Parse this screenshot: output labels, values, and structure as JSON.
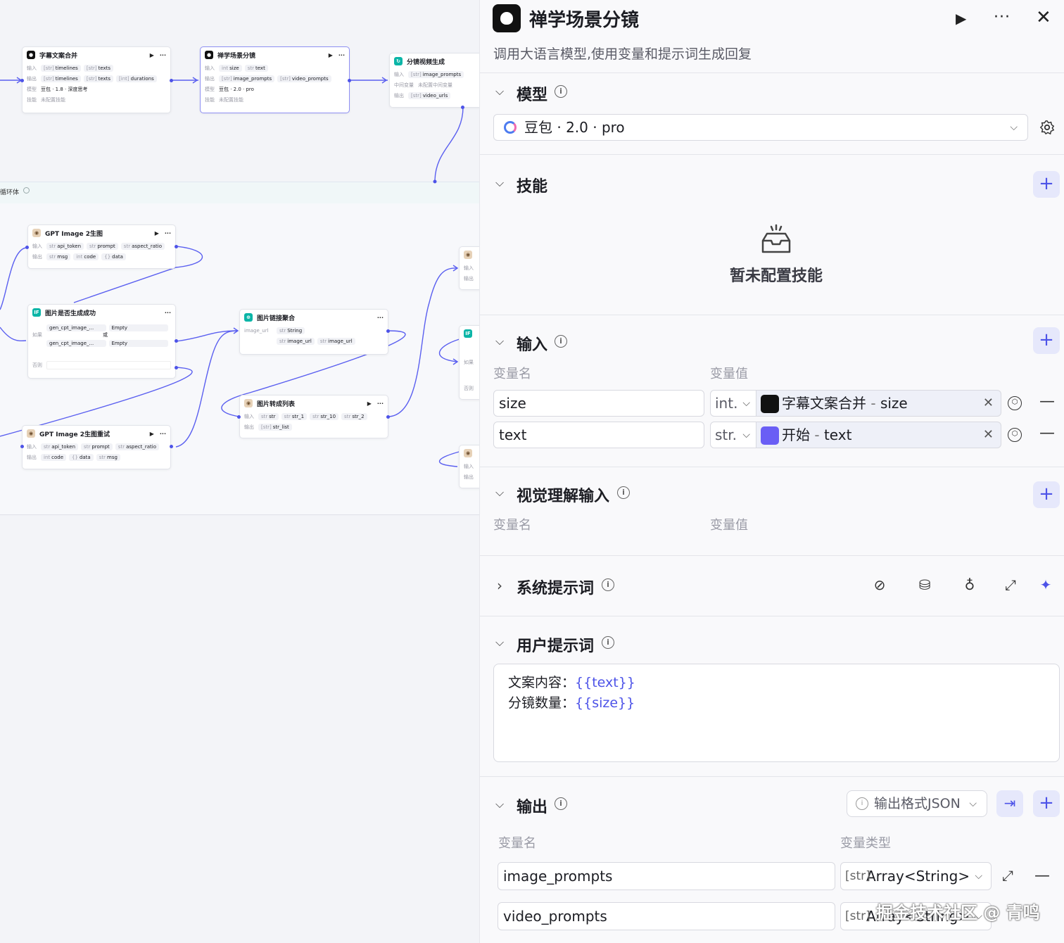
{
  "canvas": {
    "loop_label": "循环体",
    "labels": {
      "input": "输入",
      "output": "输出",
      "model": "模型",
      "skill": "技能",
      "if": "如果",
      "else": "否则",
      "mid_var": "中间变量"
    },
    "nodes": {
      "subtitle_merge": {
        "title": "字幕文案合并",
        "in": [
          "timelines",
          "texts"
        ],
        "out": [
          "timelines",
          "texts",
          "durations"
        ],
        "model": "豆包 · 1.8 · 深度思考",
        "skill": "未配置技能"
      },
      "scene_split": {
        "title": "禅学场景分镜",
        "in": [
          "size",
          "text"
        ],
        "out": [
          "image_prompts",
          "video_prompts"
        ],
        "model": "豆包 · 2.0 · pro",
        "skill": "未配置技能"
      },
      "storyboard_video": {
        "title": "分镜视频生成",
        "in": [
          "image_prompts"
        ],
        "mid": "未配置中间变量",
        "out": [
          "video_urls"
        ]
      },
      "gpt_image": {
        "title": "GPT Image 2生图",
        "in": [
          "api_token",
          "prompt",
          "aspect_ratio"
        ],
        "out": [
          "msg",
          "code",
          "data"
        ]
      },
      "image_check": {
        "title": "图片是否生成成功",
        "rows": [
          "gen_cpt_image_...",
          "gen_cpt_image_..."
        ],
        "value": "Empty",
        "op": "或"
      },
      "image_link": {
        "title": "图片链接聚合",
        "in": [
          "image_url"
        ],
        "type": "String",
        "out": [
          "image_url",
          "image_url"
        ]
      },
      "image_to_list": {
        "title": "图片转成列表",
        "in": [
          "str",
          "str_1",
          "str_10",
          "str_2"
        ],
        "out": [
          "str_list"
        ]
      },
      "gpt_retry": {
        "title": "GPT Image 2生图重试",
        "in": [
          "api_token",
          "prompt",
          "aspect_ratio"
        ],
        "out": [
          "code",
          "data",
          "msg"
        ]
      }
    }
  },
  "panel": {
    "title": "禅学场景分镜",
    "description": "调用大语言模型,使用变量和提示词生成回复",
    "model": {
      "title": "模型",
      "selected": "豆包 · 2.0 · pro"
    },
    "skills": {
      "title": "技能",
      "empty": "暂未配置技能"
    },
    "inputs": {
      "title": "输入",
      "col_name": "变量名",
      "col_value": "变量值",
      "rows": [
        {
          "name": "size",
          "type": "int.",
          "source": "字幕文案合并",
          "sep": " - ",
          "field": "size"
        },
        {
          "name": "text",
          "type": "str.",
          "source": "开始",
          "sep": " - ",
          "field": "text"
        }
      ]
    },
    "vision": {
      "title": "视觉理解输入",
      "col_name": "变量名",
      "col_value": "变量值"
    },
    "system_prompt": {
      "title": "系统提示词"
    },
    "user_prompt": {
      "title": "用户提示词",
      "lines": [
        {
          "label": "文案内容：",
          "var": "{{text}}"
        },
        {
          "label": "分镜数量：",
          "var": "{{size}}"
        }
      ]
    },
    "output": {
      "title": "输出",
      "format_label": "输出格式JSON",
      "col_name": "变量名",
      "col_type": "变量类型",
      "rows": [
        {
          "name": "image_prompts",
          "type": "Array<String>",
          "type_icon": "[str]"
        },
        {
          "name": "video_prompts",
          "type": "Array<String>",
          "type_icon": "[str]"
        }
      ]
    },
    "watermark": "掘金技术社区 @ 青鸣"
  },
  "colors": {
    "accent": "#4d53e8",
    "accent_bg": "#e6e8fb",
    "teal": "#0bb5a7"
  }
}
